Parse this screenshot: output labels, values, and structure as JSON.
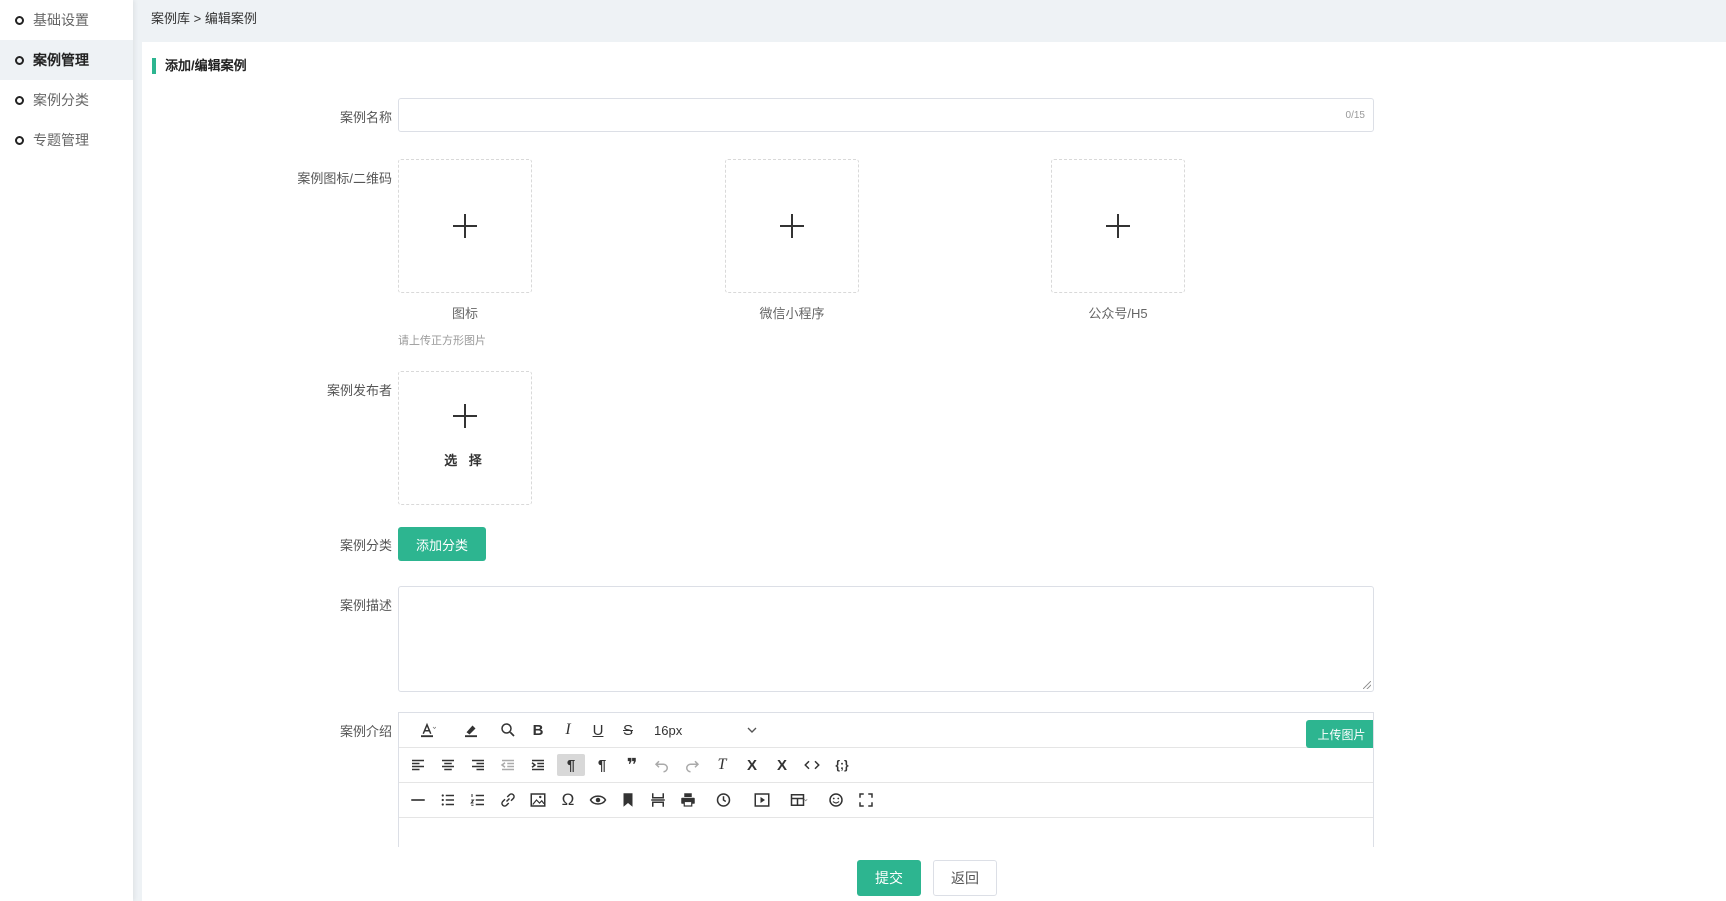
{
  "sidebar": {
    "items": [
      {
        "label": "基础设置",
        "active": false
      },
      {
        "label": "案例管理",
        "active": true
      },
      {
        "label": "案例分类",
        "active": false
      },
      {
        "label": "专题管理",
        "active": false
      }
    ]
  },
  "breadcrumb": "案例库 > 编辑案例",
  "section_title": "添加/编辑案例",
  "form": {
    "name_label": "案例名称",
    "name_counter": "0/15",
    "images_label": "案例图标/二维码",
    "uploads": [
      {
        "caption": "图标"
      },
      {
        "caption": "微信小程序"
      },
      {
        "caption": "公众号/H5"
      }
    ],
    "image_hint": "请上传正方形图片",
    "publisher_label": "案例发布者",
    "publisher_select": "选 择",
    "category_label": "案例分类",
    "add_category_button": "添加分类",
    "description_label": "案例描述",
    "intro_label": "案例介绍"
  },
  "editor": {
    "font_size": "16px",
    "upload_image_button": "上传图片"
  },
  "footer": {
    "submit": "提交",
    "back": "返回"
  },
  "colors": {
    "accent": "#2db590",
    "background": "#eef2f5"
  }
}
